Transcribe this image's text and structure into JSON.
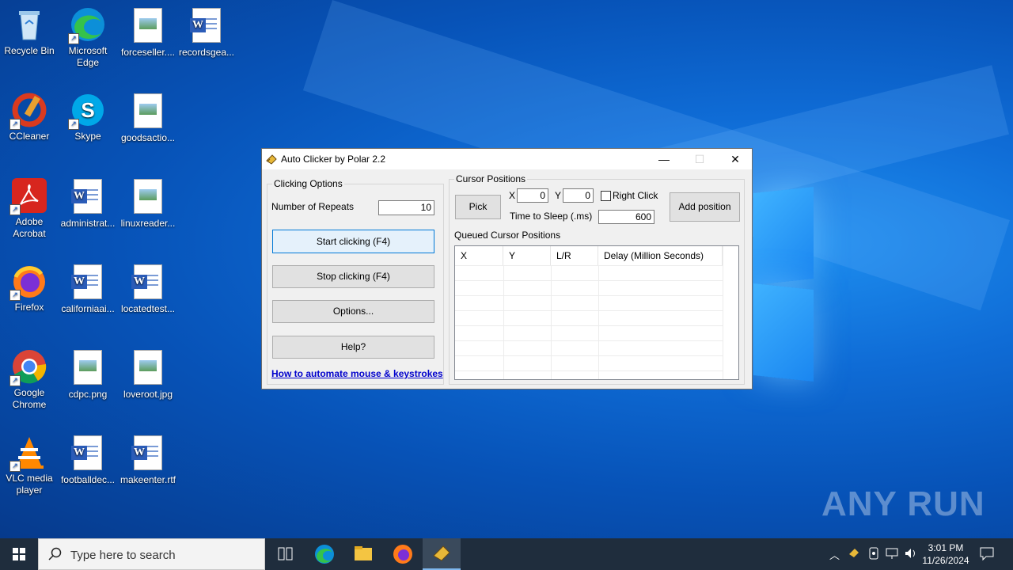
{
  "desktop": {
    "icons": [
      {
        "label": "Recycle Bin"
      },
      {
        "label": "Microsoft Edge"
      },
      {
        "label": "forceseller...."
      },
      {
        "label": "recordsgea..."
      },
      {
        "label": "CCleaner"
      },
      {
        "label": "Skype"
      },
      {
        "label": "goodsactio..."
      },
      {
        "label": "Adobe Acrobat"
      },
      {
        "label": "administrat..."
      },
      {
        "label": "linuxreader..."
      },
      {
        "label": "Firefox"
      },
      {
        "label": "californiaai..."
      },
      {
        "label": "locatedtest..."
      },
      {
        "label": "Google Chrome"
      },
      {
        "label": "cdpc.png"
      },
      {
        "label": "loveroot.jpg"
      },
      {
        "label": "VLC media player"
      },
      {
        "label": "footballdec..."
      },
      {
        "label": "makeenter.rtf"
      }
    ],
    "watermark": "ANY RUN"
  },
  "window": {
    "title": "Auto Clicker by Polar 2.2",
    "minimize_glyph": "—",
    "maximize_glyph": "☐",
    "close_glyph": "✕",
    "clicking_options": {
      "group_label": "Clicking Options",
      "repeats_label": "Number of Repeats",
      "repeats_value": "10",
      "start_label": "Start clicking (F4)",
      "stop_label": "Stop clicking (F4)",
      "options_label": "Options...",
      "help_label": "Help?",
      "link_text": "How to automate mouse & keystrokes"
    },
    "cursor_positions": {
      "group_label": "Cursor Positions",
      "pick_label": "Pick",
      "x_label": "X",
      "x_value": "0",
      "y_label": "Y",
      "y_value": "0",
      "right_click_label": "Right Click",
      "right_click_checked": false,
      "sleep_label": "Time to Sleep (.ms)",
      "sleep_value": "600",
      "add_label": "Add position",
      "queue_label": "Queued Cursor Positions",
      "columns": [
        "X",
        "Y",
        "L/R",
        "Delay (Million Seconds)"
      ]
    }
  },
  "taskbar": {
    "search_placeholder": "Type here to search",
    "time": "3:01 PM",
    "date": "11/26/2024"
  },
  "colors": {
    "accent": "#0078d7",
    "link": "#0000cc",
    "taskbar": "#1f2d3d"
  }
}
